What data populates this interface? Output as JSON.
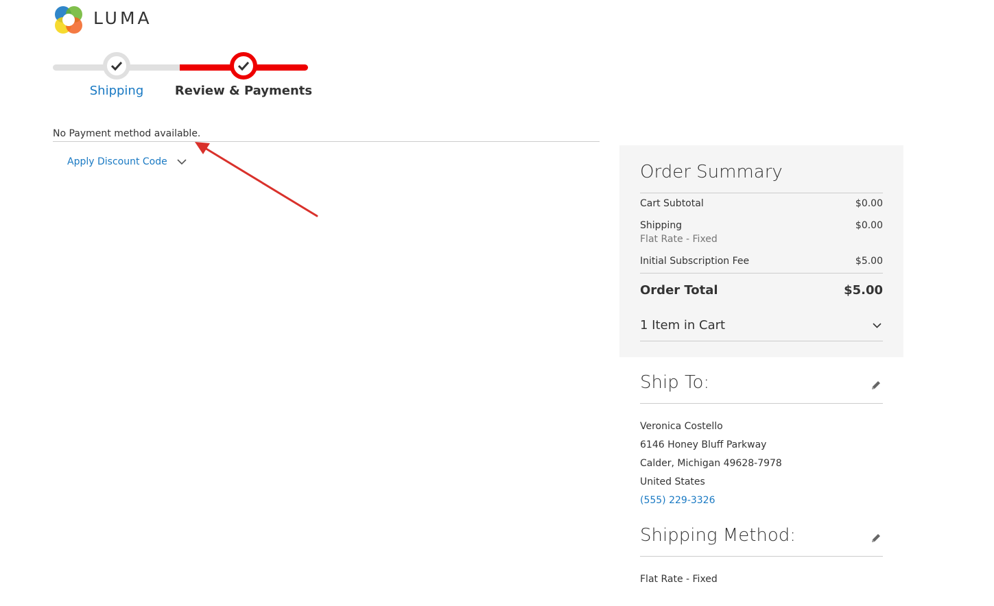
{
  "brand": {
    "name": "LUMA"
  },
  "progress": {
    "steps": [
      {
        "label": "Shipping",
        "state": "complete"
      },
      {
        "label": "Review & Payments",
        "state": "active"
      }
    ]
  },
  "payment": {
    "message": "No Payment method available.",
    "discount_label": "Apply Discount Code"
  },
  "summary": {
    "title": "Order Summary",
    "rows": [
      {
        "label": "Cart Subtotal",
        "value": "$0.00"
      },
      {
        "label": "Shipping",
        "sublabel": "Flat Rate - Fixed",
        "value": "$0.00"
      },
      {
        "label": "Initial Subscription Fee",
        "value": "$5.00"
      }
    ],
    "total_label": "Order Total",
    "total_value": "$5.00",
    "items_label": "1 Item in Cart"
  },
  "ship_to": {
    "title": "Ship To:",
    "name": "Veronica Costello",
    "street": "6146 Honey Bluff Parkway",
    "city_line": "Calder, Michigan 49628-7978",
    "country": "United States",
    "phone": "(555) 229-3326"
  },
  "shipping_method": {
    "title": "Shipping Method:",
    "value": "Flat Rate - Fixed"
  },
  "colors": {
    "accent_red": "#ee0000",
    "link_blue": "#1979c3",
    "summary_bg": "#f5f5f5"
  }
}
